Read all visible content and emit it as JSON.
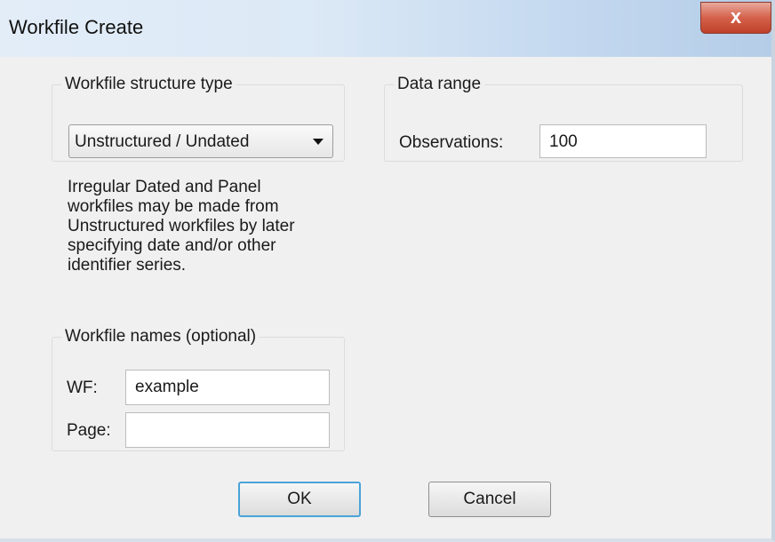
{
  "window": {
    "title": "Workfile Create",
    "close_glyph": "x"
  },
  "structure": {
    "legend": "Workfile structure type",
    "selected": "Unstructured / Undated",
    "description": "Irregular Dated and Panel\nworkfiles may be made from\nUnstructured workfiles by later\nspecifying date and/or other\nidentifier series."
  },
  "range": {
    "legend": "Data range",
    "obs_label": "Observations:",
    "obs_value": "100"
  },
  "names": {
    "legend": "Workfile names (optional)",
    "wf_label": "WF:",
    "wf_value": "example",
    "page_label": "Page:",
    "page_value": ""
  },
  "buttons": {
    "ok": "OK",
    "cancel": "Cancel"
  }
}
